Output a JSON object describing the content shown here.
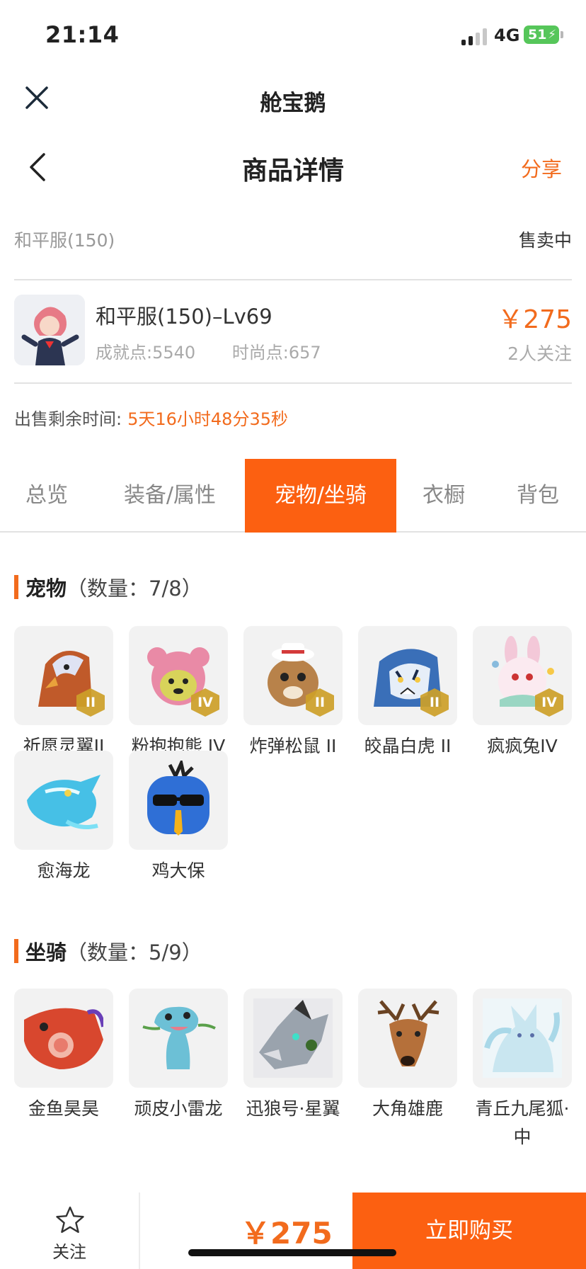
{
  "status_bar": {
    "time": "21:14",
    "network": "4G",
    "battery": "51"
  },
  "web_header": {
    "title": "舱宝鹅"
  },
  "nav": {
    "title": "商品详情",
    "share": "分享"
  },
  "server": {
    "name": "和平服(150)",
    "status": "售卖中"
  },
  "product": {
    "title": "和平服(150)–Lv69",
    "achievement": "成就点:5540",
    "fashion": "时尚点:657",
    "price": "￥275",
    "watchers": "2人关注"
  },
  "countdown": {
    "label": "出售剩余时间:",
    "value": "5天16小时48分35秒"
  },
  "tabs": [
    "总览",
    "装备/属性",
    "宠物/坐骑",
    "衣橱",
    "背包"
  ],
  "active_tab": "宠物/坐骑",
  "pets": {
    "title": "宠物",
    "count": "（数量：7/8）",
    "items": [
      {
        "name": "祈愿灵翼II",
        "tier": "II",
        "icon": "eagle-icon",
        "color": "#c05a2a"
      },
      {
        "name": "粉抱抱熊 IV",
        "tier": "IV",
        "icon": "bear-icon",
        "color": "#e98aa6"
      },
      {
        "name": "炸弹松鼠 II",
        "tier": "II",
        "icon": "squirrel-icon",
        "color": "#b8824a"
      },
      {
        "name": "皎晶白虎 II",
        "tier": "II",
        "icon": "tiger-icon",
        "color": "#3a6fb8"
      },
      {
        "name": "疯疯兔IV",
        "tier": "IV",
        "icon": "rabbit-icon",
        "color": "#f3c8d8"
      },
      {
        "name": "愈海龙",
        "tier": "",
        "icon": "sea-dragon-icon",
        "color": "#46c0e6"
      },
      {
        "name": "鸡大保",
        "tier": "",
        "icon": "bird-icon",
        "color": "#2f6fd6"
      }
    ]
  },
  "mounts": {
    "title": "坐骑",
    "count": "（数量：5/9）",
    "items": [
      {
        "name": "金鱼昊昊",
        "icon": "goldfish-icon",
        "color": "#d8472e"
      },
      {
        "name": "顽皮小雷龙",
        "icon": "dinosaur-icon",
        "color": "#6cc0d6"
      },
      {
        "name": "迅狼号·星翼",
        "icon": "mech-wolf-icon",
        "color": "#9aa3ad"
      },
      {
        "name": "大角雄鹿",
        "icon": "deer-icon",
        "color": "#b5703a"
      },
      {
        "name": "青丘九尾狐·中",
        "icon": "fox-icon",
        "color": "#c9e6f0"
      }
    ]
  },
  "bottom": {
    "follow": "关注",
    "price": "￥275",
    "buy": "立即购买"
  },
  "colors": {
    "accent": "#f26b1d",
    "tab_active": "#fc6011"
  }
}
